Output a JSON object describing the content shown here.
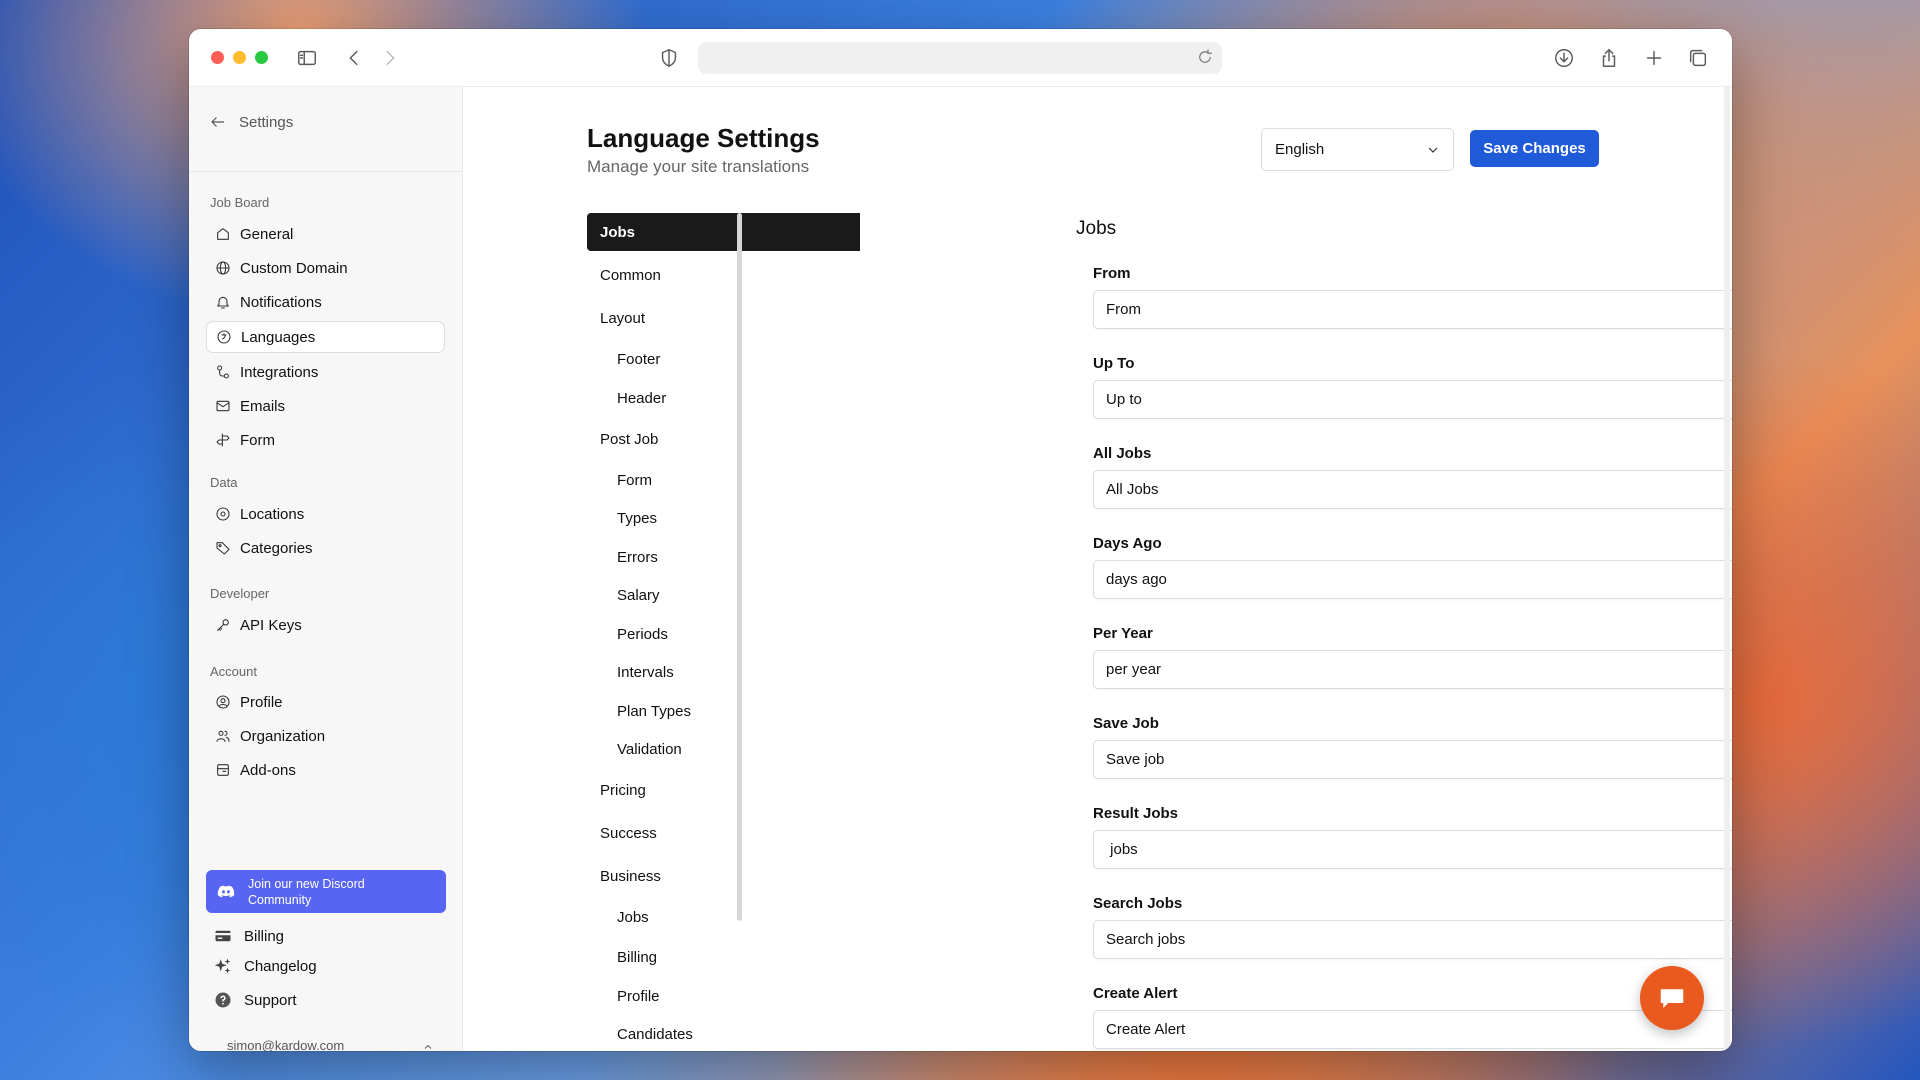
{
  "sidebar": {
    "back_label": "Settings",
    "groups": [
      {
        "label": "Job Board"
      },
      {
        "label": "Data"
      },
      {
        "label": "Developer"
      },
      {
        "label": "Account"
      }
    ],
    "items": [
      {
        "label": "General"
      },
      {
        "label": "Custom Domain"
      },
      {
        "label": "Notifications"
      },
      {
        "label": "Languages"
      },
      {
        "label": "Integrations"
      },
      {
        "label": "Emails"
      },
      {
        "label": "Form"
      },
      {
        "label": "Locations"
      },
      {
        "label": "Categories"
      },
      {
        "label": "API Keys"
      },
      {
        "label": "Profile"
      },
      {
        "label": "Organization"
      },
      {
        "label": "Add-ons"
      }
    ],
    "discord_label": "Join our new Discord Community",
    "bottom": [
      {
        "label": "Billing"
      },
      {
        "label": "Changelog"
      },
      {
        "label": "Support"
      }
    ],
    "user_email": "simon@kardow.com"
  },
  "header": {
    "title": "Language Settings",
    "subtitle": "Manage your site translations",
    "language_selected": "English",
    "save_label": "Save Changes"
  },
  "nav": [
    {
      "label": "Jobs"
    },
    {
      "label": "Common"
    },
    {
      "label": "Layout"
    },
    {
      "label": "Footer"
    },
    {
      "label": "Header"
    },
    {
      "label": "Post Job"
    },
    {
      "label": "Form"
    },
    {
      "label": "Types"
    },
    {
      "label": "Errors"
    },
    {
      "label": "Salary"
    },
    {
      "label": "Periods"
    },
    {
      "label": "Intervals"
    },
    {
      "label": "Plan Types"
    },
    {
      "label": "Validation"
    },
    {
      "label": "Pricing"
    },
    {
      "label": "Success"
    },
    {
      "label": "Business"
    },
    {
      "label": "Jobs"
    },
    {
      "label": "Billing"
    },
    {
      "label": "Profile"
    },
    {
      "label": "Candidates"
    }
  ],
  "section": {
    "title": "Jobs",
    "fields": [
      {
        "label": "From",
        "value": "From"
      },
      {
        "label": "Up To",
        "value": "Up to"
      },
      {
        "label": "All Jobs",
        "value": "All Jobs"
      },
      {
        "label": "Days Ago",
        "value": "days ago"
      },
      {
        "label": "Per Year",
        "value": "per year"
      },
      {
        "label": "Save Job",
        "value": "Save job"
      },
      {
        "label": "Result Jobs",
        "value": " jobs"
      },
      {
        "label": "Search Jobs",
        "value": "Search jobs"
      },
      {
        "label": "Create Alert",
        "value": "Create Alert"
      }
    ]
  },
  "colors": {
    "accent": "#1f5ad9",
    "discord": "#5865f2",
    "chat": "#ea5a1e"
  }
}
